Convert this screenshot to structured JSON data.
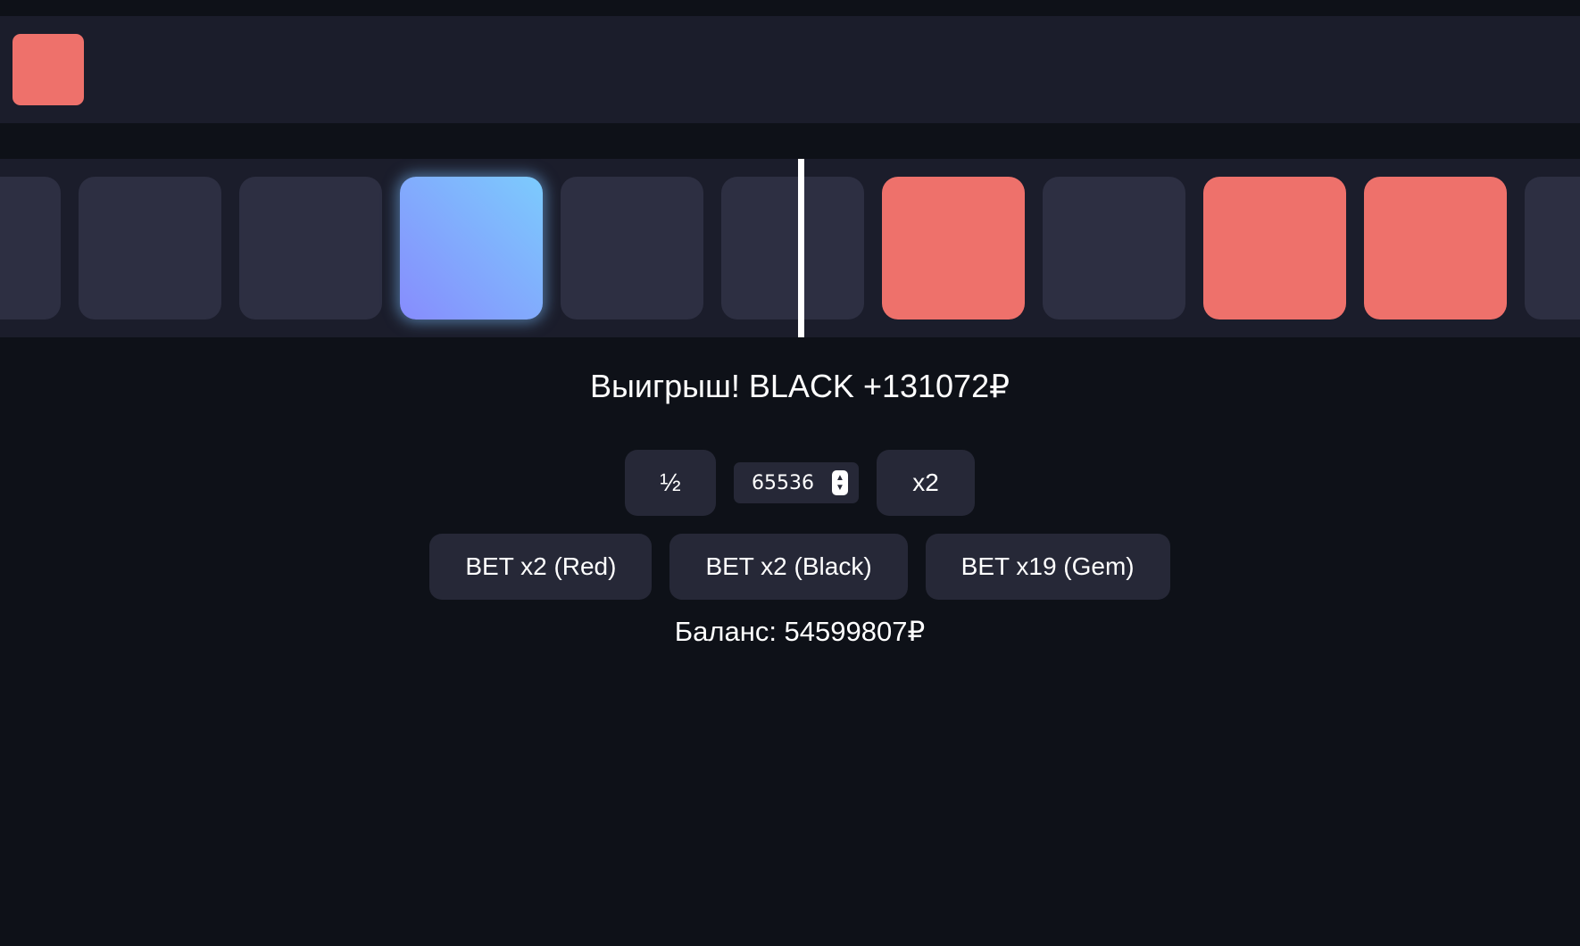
{
  "history": {
    "items": [
      {
        "color": "red",
        "hex": "#ee716b"
      }
    ]
  },
  "roulette": {
    "tiles": [
      "black",
      "black",
      "black",
      "gem",
      "black",
      "black",
      "red",
      "black",
      "red",
      "red",
      "black"
    ],
    "colors": {
      "red": "#ee716b",
      "black": "#2d2f42",
      "gem_from": "#7ccbfd",
      "gem_to": "#878cfd"
    }
  },
  "result": {
    "text": "Выигрыш! BLACK +131072₽"
  },
  "controls": {
    "half_label": "½",
    "amount_value": "65536",
    "double_label": "x2"
  },
  "bets": {
    "red_label": "BET x2 (Red)",
    "black_label": "BET x2 (Black)",
    "gem_label": "BET x19 (Gem)"
  },
  "balance": {
    "text": "Баланс: 54599807₽"
  }
}
